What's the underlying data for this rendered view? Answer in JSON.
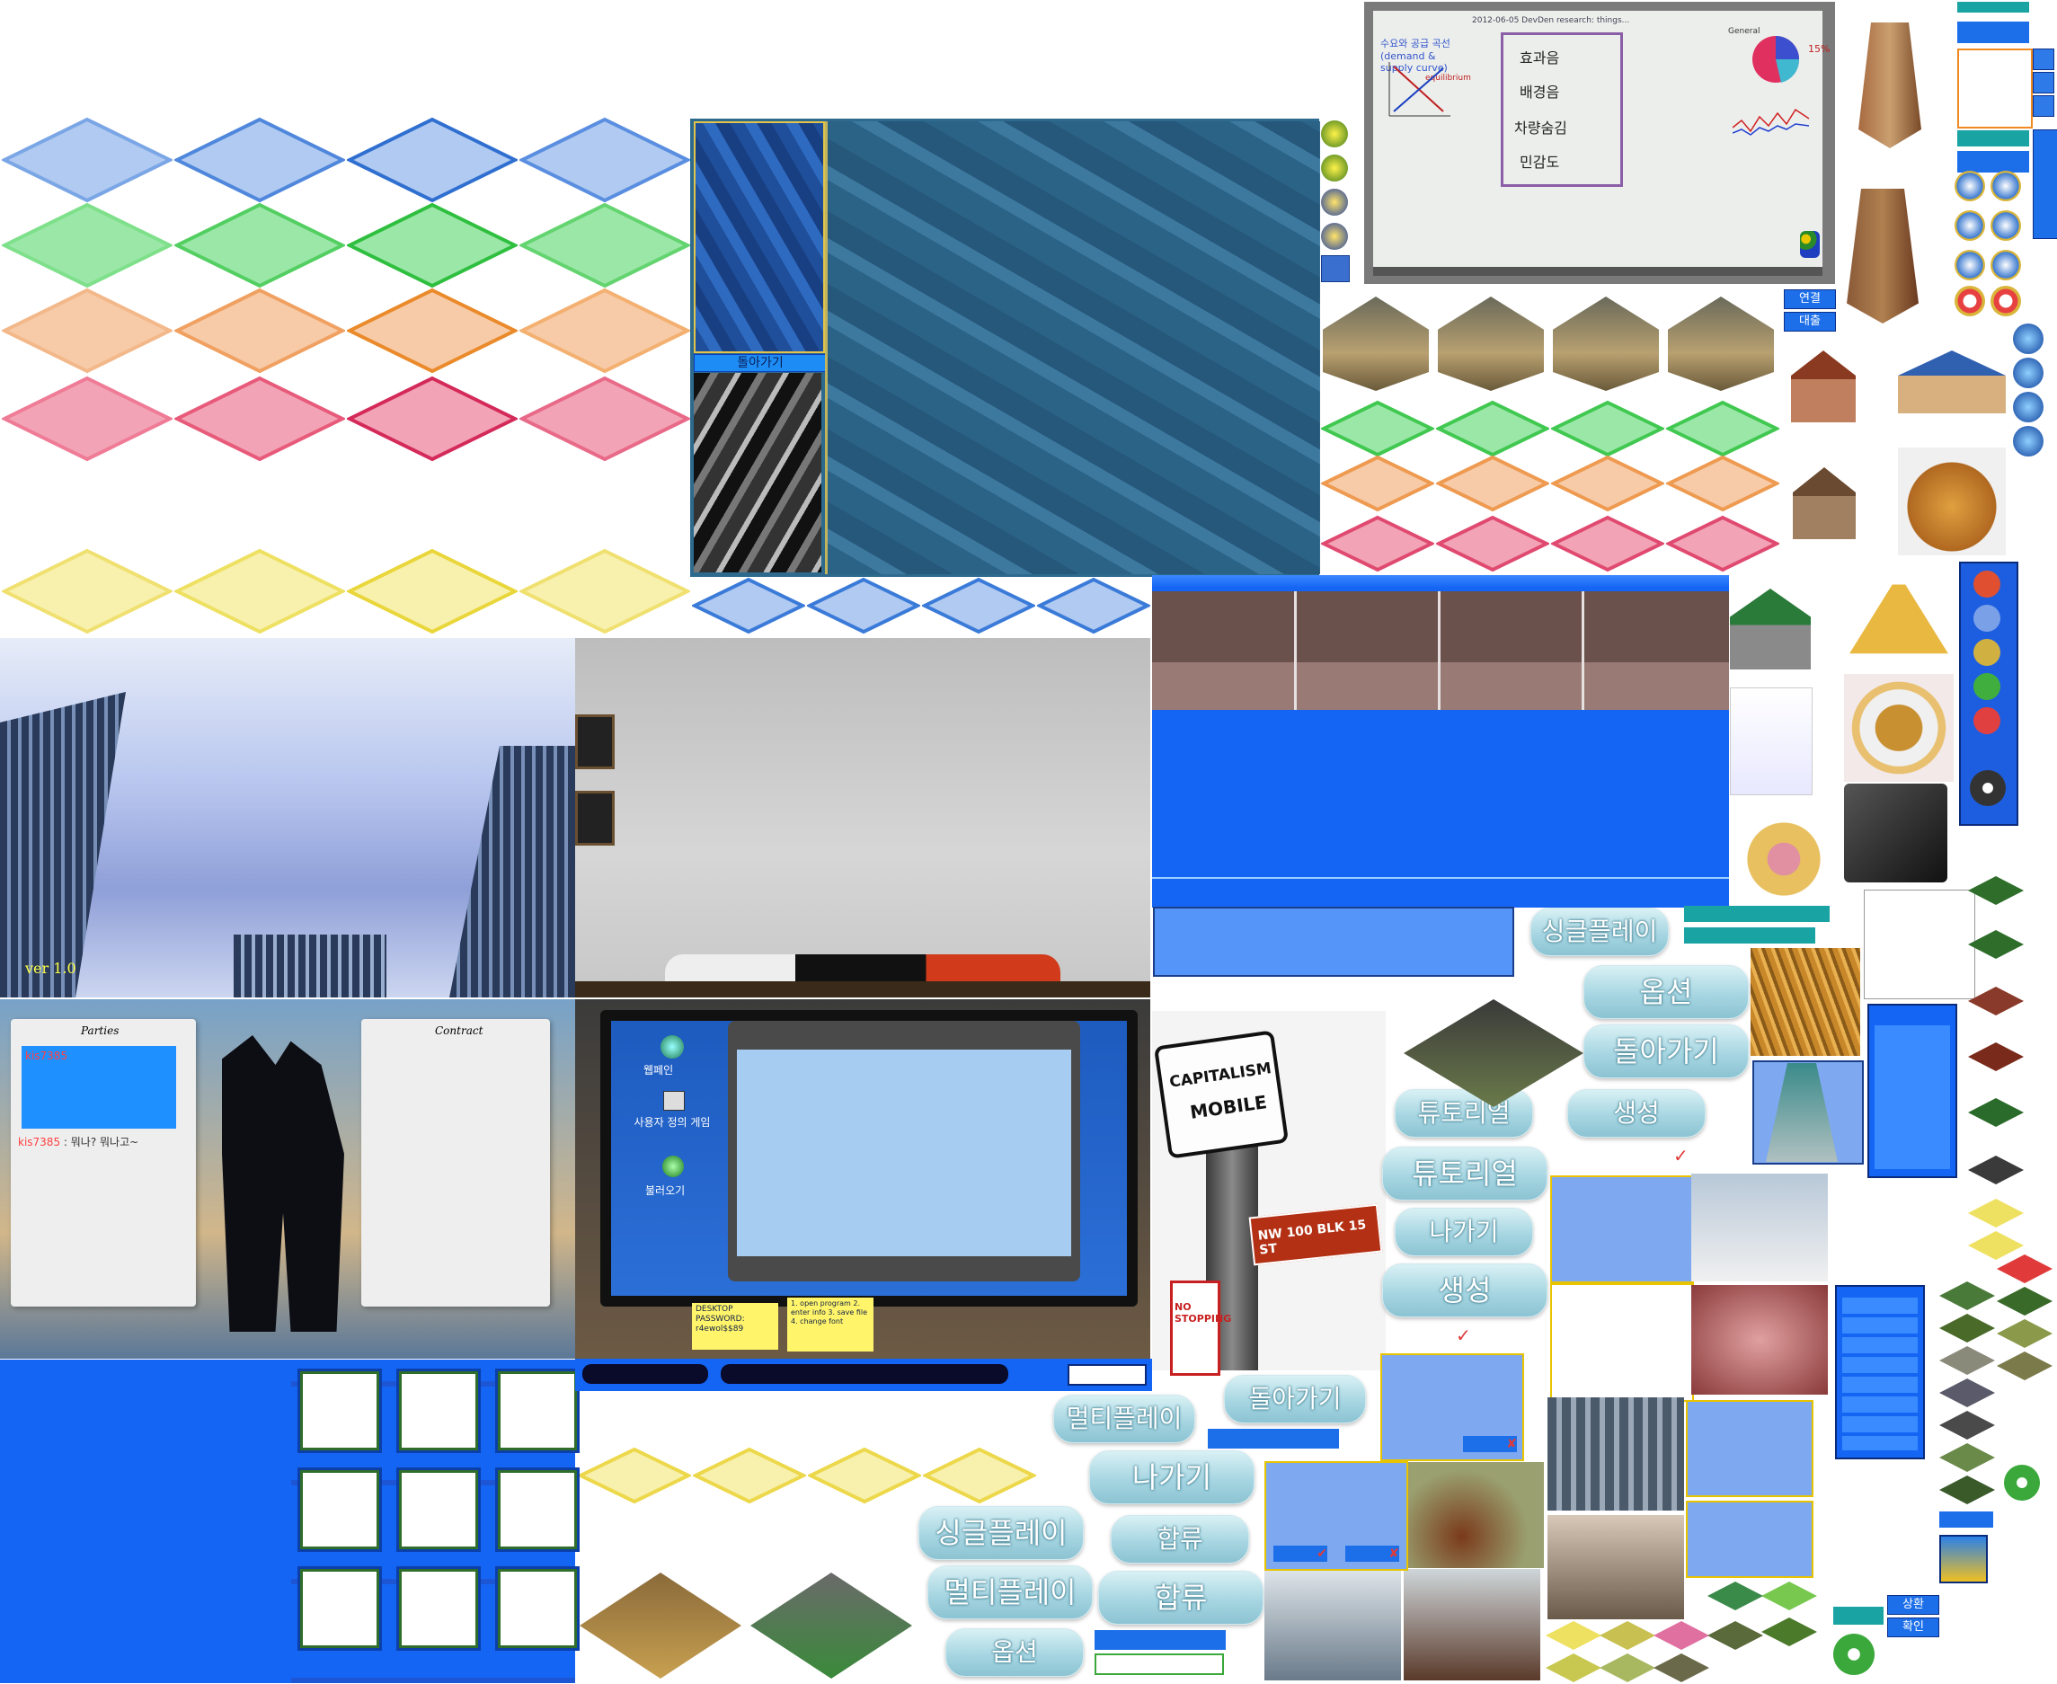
{
  "city_panel": {
    "back_label": "돌아가기"
  },
  "title_screen": {
    "version": "ver 1.0"
  },
  "whiteboard": {
    "title_scribble": "2012-06-05   DevDen   research: things...",
    "left_heading": "수요와 공급 곡선 (demand & supply curve)",
    "equilibrium": "equilibrium",
    "terms": [
      "효과음",
      "배경음",
      "차량숨김",
      "민감도"
    ],
    "general": "General",
    "percent": "15%"
  },
  "small_buttons": {
    "connect": "연결",
    "loan": "대출",
    "repay": "상환",
    "confirm": "확인"
  },
  "trade_panel": {
    "parties_title": "Parties",
    "contract_title": "Contract",
    "user": "kis7385",
    "chat_user": "kis7385",
    "chat_text": " : 뭐나? 뭐나고~"
  },
  "desktop": {
    "icons": [
      "웹페인",
      "사용자 정의 게임",
      "불러오기"
    ],
    "sticky1": "DESKTOP PASSWORD: r4ewol$$89",
    "sticky2": "1. open program 2. enter info 3. save file 4. change font"
  },
  "sign": {
    "line1": "CAPITALISM",
    "line2": "MOBILE",
    "street": "NW 100 BLK 15 ST",
    "no_stopping": "NO STOPPING"
  },
  "menu_buttons": {
    "single_small": "싱글플레이",
    "options": "옵션",
    "back": "돌아가기",
    "tutorial_small": "튜토리얼",
    "create_small": "생성",
    "tutorial": "튜토리얼",
    "exit": "나가기",
    "create": "생성",
    "multi_small": "멀티플레이",
    "back2": "돌아가기",
    "exit2": "나가기",
    "merge_small": "합류",
    "single": "싱글플레이",
    "multi": "멀티플레이",
    "merge": "합류",
    "options2": "옵션"
  },
  "colors": {
    "blue_dia": "#6f9fe6",
    "green_dia": "#49d461",
    "orange_dia": "#f0a060",
    "red_dia": "#e85a7a",
    "yellow_dia": "#f3e36a",
    "panel_blue": "#1565f4",
    "button_teal": "#a7d6e2"
  }
}
